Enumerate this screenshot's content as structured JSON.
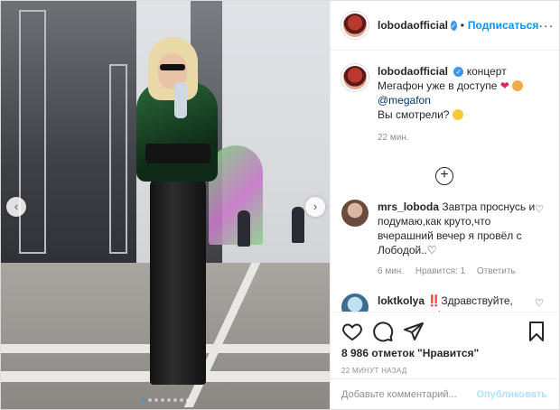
{
  "post": {
    "username": "lobodaofficial",
    "follow_label": "Подписаться",
    "separator": "•",
    "caption_text": "концерт Мегафон уже в доступе",
    "caption_mention": "@megafon",
    "caption_question": "Вы смотрели?",
    "caption_time": "22 мин.",
    "likes": "8 986 отметок \"Нравится\"",
    "post_time": "22 МИНУТ НАЗАД",
    "comment_placeholder": "Добавьте комментарий...",
    "publish_label": "Опубликовать"
  },
  "comments": [
    {
      "username": "mrs_loboda",
      "text": "Завтра проснусь и подумаю,как круто,что вчерашний вечер я провёл с Лободой..♡",
      "time": "6 мин.",
      "likes": "Нравится: 1",
      "reply": "Ответить"
    },
    {
      "username": "loktkolya",
      "text": "‼️Здравствуйте, меня зовут Анастасия, я мама мальчика Коли. У Коли"
    }
  ],
  "carousel": {
    "total": 8,
    "active": 0
  },
  "icons": {
    "heart": "heart-icon",
    "comment": "comment-icon",
    "share": "share-icon",
    "bookmark": "bookmark-icon"
  }
}
